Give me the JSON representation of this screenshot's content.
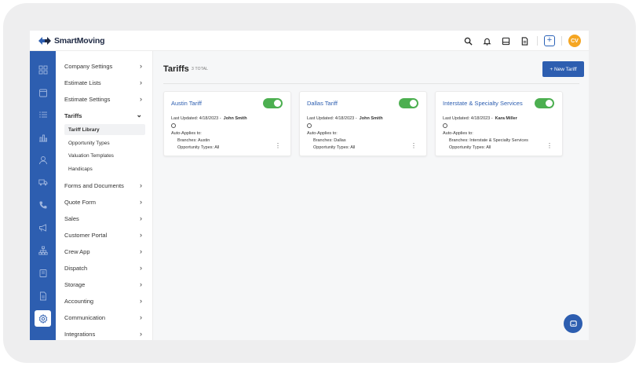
{
  "brand": {
    "name": "SmartMoving",
    "accent": "#2d5eb0",
    "toggle_on": "#4caf50",
    "avatar_color": "#f5a623"
  },
  "topbar": {
    "icons": [
      "search-icon",
      "bell-icon",
      "inbox-icon",
      "document-icon",
      "add-icon"
    ],
    "avatar_initials": "CV"
  },
  "rail": {
    "items": [
      "dashboard-icon",
      "calendar-icon",
      "list-icon",
      "reports-icon",
      "customers-icon",
      "truck-icon",
      "phone-icon",
      "megaphone-icon",
      "network-icon",
      "book-icon",
      "file-icon",
      "settings-icon"
    ],
    "active": "settings-icon"
  },
  "subnav": {
    "items": [
      {
        "label": "Company Settings"
      },
      {
        "label": "Estimate Lists"
      },
      {
        "label": "Estimate Settings"
      },
      {
        "label": "Tariffs"
      },
      {
        "label": "Forms and Documents"
      },
      {
        "label": "Quote Form"
      },
      {
        "label": "Sales"
      },
      {
        "label": "Customer Portal"
      },
      {
        "label": "Crew App"
      },
      {
        "label": "Dispatch"
      },
      {
        "label": "Storage"
      },
      {
        "label": "Accounting"
      },
      {
        "label": "Communication"
      },
      {
        "label": "Integrations"
      }
    ],
    "tariffs_children": [
      "Tariff Library",
      "Opportunity Types",
      "Valuation Templates",
      "Handicaps"
    ],
    "active_child": "Tariff Library"
  },
  "main": {
    "title": "Tariffs",
    "count": "3 TOTAL",
    "new_button": "+ New Tariff",
    "cards": [
      {
        "title": "Austin Tariff",
        "enabled": true,
        "updated_prefix": "Last Updated: 4/18/2023 -",
        "updated_by": "John Smith",
        "auto_applies": "Auto-Applies to:",
        "branches": "Branches: Austin",
        "opportunity": "Opportunity Types: All"
      },
      {
        "title": "Dallas Tariff",
        "enabled": true,
        "updated_prefix": "Last Updated: 4/18/2023 -",
        "updated_by": "John Smith",
        "auto_applies": "Auto-Applies to:",
        "branches": "Branches: Dallas",
        "opportunity": "Opportunity Types: All"
      },
      {
        "title": "Interstate & Specialty Services",
        "enabled": true,
        "updated_prefix": "Last Updated: 4/18/2023 -",
        "updated_by": "Kara Miller",
        "auto_applies": "Auto-Applies to:",
        "branches": "Branches: Interstate & Specialty Services",
        "opportunity": "Opportunity Types: All"
      }
    ]
  }
}
